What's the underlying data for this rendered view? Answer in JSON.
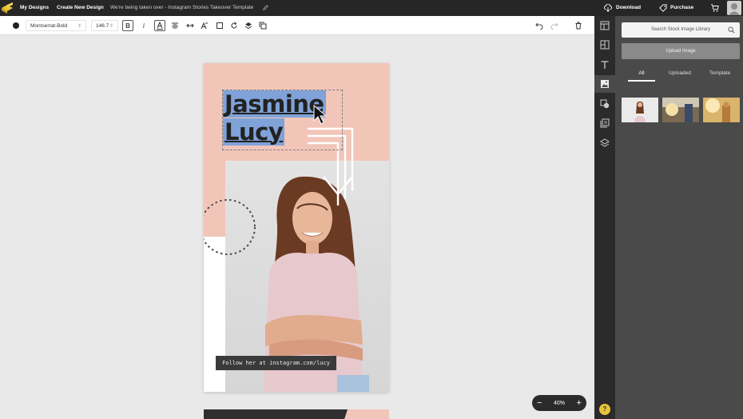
{
  "topbar": {
    "my_designs": "My Designs",
    "create_new": "Create New Design",
    "doc_title": "We're being taken over - Instagram Stories Takeover Template",
    "download": "Download",
    "purchase": "Purchase"
  },
  "toolbar": {
    "font_family": "Montserrat-Bold",
    "font_size": "146.7",
    "bold": "B",
    "italic": "i"
  },
  "design": {
    "headline_line1": "Jasmine",
    "headline_line2": "Lucy",
    "caption": "Follow her at instagram.com/lucy"
  },
  "zoom": {
    "minus": "−",
    "level": "40%",
    "plus": "+"
  },
  "panel": {
    "search_placeholder": "Search Stock Image Library",
    "upload": "Upload Image",
    "tabs": [
      "All",
      "Uploaded",
      "Template"
    ]
  },
  "help": "?",
  "colors": {
    "topbar": "#262626",
    "panel": "#4a4a4a",
    "page_pink": "#f2c5b9",
    "selection": "#7fa2d8",
    "help": "#e9c43a"
  }
}
